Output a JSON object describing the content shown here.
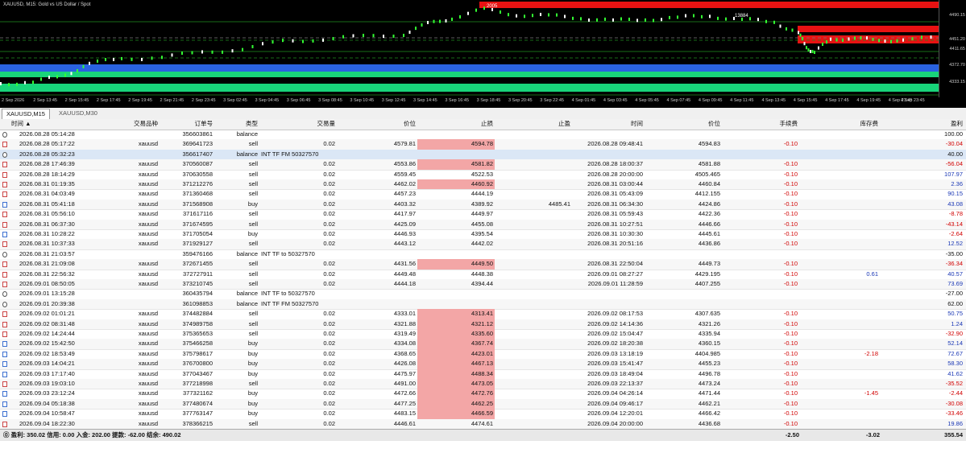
{
  "chart": {
    "title": "XAUUSD, M15:  Gold vs US Dollar / Spot",
    "price_labels": [
      "4490.15",
      "4451.20",
      "4411.65",
      "4372.70",
      "4333.15"
    ],
    "time_labels": [
      "2 Sep 2026",
      "2 Sep 13:45",
      "2 Sep 15:45",
      "2 Sep 17:45",
      "2 Sep 19:45",
      "2 Sep 21:45",
      "2 Sep 23:45",
      "3 Sep 02:45",
      "3 Sep 04:45",
      "3 Sep 06:45",
      "3 Sep 08:45",
      "3 Sep 10:45",
      "3 Sep 12:45",
      "3 Sep 14:45",
      "3 Sep 16:45",
      "3 Sep 18:45",
      "3 Sep 20:45",
      "3 Sep 22:45",
      "4 Sep 01:45",
      "4 Sep 03:45",
      "4 Sep 05:45",
      "4 Sep 07:45",
      "4 Sep 09:45",
      "4 Sep 11:45",
      "4 Sep 13:45",
      "4 Sep 15:45",
      "4 Sep 17:45",
      "4 Sep 19:45",
      "4 Sep 21:45",
      "4 Sep 23:45"
    ],
    "marker1": "2005",
    "marker2": "13884",
    "current_price": "4451.20",
    "colors": {
      "red_zone": "#e81212",
      "green_zone": "#18d47a",
      "blue_zone": "#2a62e0",
      "candle_up": "#33ff33",
      "candle_down": "#ffffff"
    }
  },
  "tabs": [
    {
      "label": "XAUUSD,M15",
      "active": true
    },
    {
      "label": "XAUUSD,M30",
      "active": false
    }
  ],
  "table": {
    "headers": [
      "时间",
      "交易品种",
      "订单号",
      "类型",
      "交易量",
      "价位",
      "止损",
      "止盈",
      "时间",
      "价位",
      "手续费",
      "库存费",
      "盈利"
    ],
    "rows": [
      {
        "icon": "bal",
        "time": "2026.08.28 05:14:28",
        "symbol": "",
        "order": "356603861",
        "type": "balance",
        "volume": "",
        "price": "",
        "sl": "",
        "tp": "",
        "ctime": "",
        "cprice": "",
        "commission": "",
        "swap": "",
        "profit": "100.00",
        "comment": "",
        "profit_sign": "bal"
      },
      {
        "icon": "sell",
        "time": "2026.08.28 05:17:22",
        "symbol": "xauusd",
        "order": "369641723",
        "type": "sell",
        "volume": "0.02",
        "price": "4579.81",
        "sl": "4594.78",
        "sl_hl": true,
        "tp": "",
        "ctime": "2026.08.28 09:48:41",
        "cprice": "4594.83",
        "commission": "-0.10",
        "swap": "",
        "profit": "-30.04",
        "profit_sign": "neg"
      },
      {
        "icon": "bal",
        "time": "2026.08.28 05:32:23",
        "symbol": "",
        "order": "356617407",
        "type": "balance",
        "volume": "",
        "price": "",
        "sl": "",
        "tp": "",
        "ctime": "",
        "cprice": "",
        "commission": "",
        "swap": "",
        "profit": "40.00",
        "comment": "INT TF FM 50327570",
        "profit_sign": "bal",
        "selected": true
      },
      {
        "icon": "sell",
        "time": "2026.08.28 17:46:39",
        "symbol": "xauusd",
        "order": "370560087",
        "type": "sell",
        "volume": "0.02",
        "price": "4553.86",
        "sl": "4581.82",
        "sl_hl": true,
        "tp": "",
        "ctime": "2026.08.28 18:00:37",
        "cprice": "4581.88",
        "commission": "-0.10",
        "swap": "",
        "profit": "-56.04",
        "profit_sign": "neg"
      },
      {
        "icon": "sell",
        "time": "2026.08.28 18:14:29",
        "symbol": "xauusd",
        "order": "370630558",
        "type": "sell",
        "volume": "0.02",
        "price": "4559.45",
        "sl": "4522.53",
        "tp": "",
        "ctime": "2026.08.28 20:00:00",
        "cprice": "4505.465",
        "commission": "-0.10",
        "swap": "",
        "profit": "107.97",
        "profit_sign": "pos"
      },
      {
        "icon": "sell",
        "time": "2026.08.31 01:19:35",
        "symbol": "xauusd",
        "order": "371212276",
        "type": "sell",
        "volume": "0.02",
        "price": "4462.02",
        "sl": "4460.92",
        "sl_hl": true,
        "tp": "",
        "ctime": "2026.08.31 03:00:44",
        "cprice": "4460.84",
        "commission": "-0.10",
        "swap": "",
        "profit": "2.36",
        "profit_sign": "pos"
      },
      {
        "icon": "sell",
        "time": "2026.08.31 04:03:49",
        "symbol": "xauusd",
        "order": "371360468",
        "type": "sell",
        "volume": "0.02",
        "price": "4457.23",
        "sl": "4444.19",
        "tp": "",
        "ctime": "2026.08.31 05:43:09",
        "cprice": "4412.155",
        "commission": "-0.10",
        "swap": "",
        "profit": "90.15",
        "profit_sign": "pos"
      },
      {
        "icon": "buy",
        "time": "2026.08.31 05:41:18",
        "symbol": "xauusd",
        "order": "371568908",
        "type": "buy",
        "volume": "0.02",
        "price": "4403.32",
        "sl": "4389.92",
        "tp": "4485.41",
        "ctime": "2026.08.31 06:34:30",
        "cprice": "4424.86",
        "commission": "-0.10",
        "swap": "",
        "profit": "43.08",
        "profit_sign": "pos"
      },
      {
        "icon": "sell",
        "time": "2026.08.31 05:56:10",
        "symbol": "xauusd",
        "order": "371617116",
        "type": "sell",
        "volume": "0.02",
        "price": "4417.97",
        "sl": "4449.97",
        "tp": "",
        "ctime": "2026.08.31 05:59:43",
        "cprice": "4422.36",
        "commission": "-0.10",
        "swap": "",
        "profit": "-8.78",
        "profit_sign": "neg"
      },
      {
        "icon": "sell",
        "time": "2026.08.31 06:37:30",
        "symbol": "xauusd",
        "order": "371674595",
        "type": "sell",
        "volume": "0.02",
        "price": "4425.09",
        "sl": "4455.08",
        "tp": "",
        "ctime": "2026.08.31 10:27:51",
        "cprice": "4446.66",
        "commission": "-0.10",
        "swap": "",
        "profit": "-43.14",
        "profit_sign": "neg"
      },
      {
        "icon": "buy",
        "time": "2026.08.31 10:28:22",
        "symbol": "xauusd",
        "order": "371705054",
        "type": "buy",
        "volume": "0.02",
        "price": "4446.93",
        "sl": "4395.54",
        "tp": "",
        "ctime": "2026.08.31 10:30:30",
        "cprice": "4445.61",
        "commission": "-0.10",
        "swap": "",
        "profit": "-2.64",
        "profit_sign": "neg"
      },
      {
        "icon": "sell",
        "time": "2026.08.31 10:37:33",
        "symbol": "xauusd",
        "order": "371929127",
        "type": "sell",
        "volume": "0.02",
        "price": "4443.12",
        "sl": "4442.02",
        "tp": "",
        "ctime": "2026.08.31 20:51:16",
        "cprice": "4436.86",
        "commission": "-0.10",
        "swap": "",
        "profit": "12.52",
        "profit_sign": "pos"
      },
      {
        "icon": "bal",
        "time": "2026.08.31 21:03:57",
        "symbol": "",
        "order": "359476166",
        "type": "balance",
        "volume": "",
        "price": "",
        "sl": "",
        "tp": "",
        "ctime": "",
        "cprice": "",
        "commission": "",
        "swap": "",
        "profit": "-35.00",
        "comment": "INT TF to 50327570",
        "profit_sign": "bal"
      },
      {
        "icon": "sell",
        "time": "2026.08.31 21:09:08",
        "symbol": "xauusd",
        "order": "372671455",
        "type": "sell",
        "volume": "0.02",
        "price": "4431.56",
        "sl": "4449.50",
        "sl_hl": true,
        "tp": "",
        "ctime": "2026.08.31 22:50:04",
        "cprice": "4449.73",
        "commission": "-0.10",
        "swap": "",
        "profit": "-36.34",
        "profit_sign": "neg"
      },
      {
        "icon": "sell",
        "time": "2026.08.31 22:56:32",
        "symbol": "xauusd",
        "order": "372727911",
        "type": "sell",
        "volume": "0.02",
        "price": "4449.48",
        "sl": "4448.38",
        "tp": "",
        "ctime": "2026.09.01 08:27:27",
        "cprice": "4429.195",
        "commission": "-0.10",
        "swap": "0.61",
        "profit": "40.57",
        "profit_sign": "pos"
      },
      {
        "icon": "sell",
        "time": "2026.09.01 08:50:05",
        "symbol": "xauusd",
        "order": "373210745",
        "type": "sell",
        "volume": "0.02",
        "price": "4444.18",
        "sl": "4394.44",
        "tp": "",
        "ctime": "2026.09.01 11:28:59",
        "cprice": "4407.255",
        "commission": "-0.10",
        "swap": "",
        "profit": "73.69",
        "profit_sign": "pos"
      },
      {
        "icon": "bal",
        "time": "2026.09.01 13:15:28",
        "symbol": "",
        "order": "360435794",
        "type": "balance",
        "volume": "",
        "price": "",
        "sl": "",
        "tp": "",
        "ctime": "",
        "cprice": "",
        "commission": "",
        "swap": "",
        "profit": "-27.00",
        "comment": "INT TF to 50327570",
        "profit_sign": "bal"
      },
      {
        "icon": "bal",
        "time": "2026.09.01 20:39:38",
        "symbol": "",
        "order": "361098853",
        "type": "balance",
        "volume": "",
        "price": "",
        "sl": "",
        "tp": "",
        "ctime": "",
        "cprice": "",
        "commission": "",
        "swap": "",
        "profit": "62.00",
        "comment": "INT TF FM 50327570",
        "profit_sign": "bal"
      },
      {
        "icon": "sell",
        "time": "2026.09.02 01:01:21",
        "symbol": "xauusd",
        "order": "374482884",
        "type": "sell",
        "volume": "0.02",
        "price": "4333.01",
        "sl": "4313.41",
        "sl_hl": true,
        "tp": "",
        "ctime": "2026.09.02 08:17:53",
        "cprice": "4307.635",
        "commission": "-0.10",
        "swap": "",
        "profit": "50.75",
        "profit_sign": "pos"
      },
      {
        "icon": "sell",
        "time": "2026.09.02 08:31:48",
        "symbol": "xauusd",
        "order": "374989758",
        "type": "sell",
        "volume": "0.02",
        "price": "4321.88",
        "sl": "4321.12",
        "sl_hl": true,
        "tp": "",
        "ctime": "2026.09.02 14:14:36",
        "cprice": "4321.26",
        "commission": "-0.10",
        "swap": "",
        "profit": "1.24",
        "profit_sign": "pos"
      },
      {
        "icon": "sell",
        "time": "2026.09.02 14:24:44",
        "symbol": "xauusd",
        "order": "375365653",
        "type": "sell",
        "volume": "0.02",
        "price": "4319.49",
        "sl": "4335.60",
        "sl_hl": true,
        "tp": "",
        "ctime": "2026.09.02 15:04:47",
        "cprice": "4335.94",
        "commission": "-0.10",
        "swap": "",
        "profit": "-32.90",
        "profit_sign": "neg"
      },
      {
        "icon": "buy",
        "time": "2026.09.02 15:42:50",
        "symbol": "xauusd",
        "order": "375466258",
        "type": "buy",
        "volume": "0.02",
        "price": "4334.08",
        "sl": "4367.74",
        "sl_hl": true,
        "tp": "",
        "ctime": "2026.09.02 18:20:38",
        "cprice": "4360.15",
        "commission": "-0.10",
        "swap": "",
        "profit": "52.14",
        "profit_sign": "pos"
      },
      {
        "icon": "buy",
        "time": "2026.09.02 18:53:49",
        "symbol": "xauusd",
        "order": "375798617",
        "type": "buy",
        "volume": "0.02",
        "price": "4368.65",
        "sl": "4423.01",
        "sl_hl": true,
        "tp": "",
        "ctime": "2026.09.03 13:18:19",
        "cprice": "4404.985",
        "commission": "-0.10",
        "swap": "-2.18",
        "profit": "72.67",
        "profit_sign": "pos"
      },
      {
        "icon": "buy",
        "time": "2026.09.03 14:04:21",
        "symbol": "xauusd",
        "order": "376700800",
        "type": "buy",
        "volume": "0.02",
        "price": "4426.08",
        "sl": "4467.13",
        "sl_hl": true,
        "tp": "",
        "ctime": "2026.09.03 15:41:47",
        "cprice": "4455.23",
        "commission": "-0.10",
        "swap": "",
        "profit": "58.30",
        "profit_sign": "pos"
      },
      {
        "icon": "buy",
        "time": "2026.09.03 17:17:40",
        "symbol": "xauusd",
        "order": "377043467",
        "type": "buy",
        "volume": "0.02",
        "price": "4475.97",
        "sl": "4488.34",
        "sl_hl": true,
        "tp": "",
        "ctime": "2026.09.03 18:49:04",
        "cprice": "4496.78",
        "commission": "-0.10",
        "swap": "",
        "profit": "41.62",
        "profit_sign": "pos"
      },
      {
        "icon": "sell",
        "time": "2026.09.03 19:03:10",
        "symbol": "xauusd",
        "order": "377218998",
        "type": "sell",
        "volume": "0.02",
        "price": "4491.00",
        "sl": "4473.05",
        "sl_hl": true,
        "tp": "",
        "ctime": "2026.09.03 22:13:37",
        "cprice": "4473.24",
        "commission": "-0.10",
        "swap": "",
        "profit": "-35.52",
        "profit_sign": "neg"
      },
      {
        "icon": "buy",
        "time": "2026.09.03 23:12:24",
        "symbol": "xauusd",
        "order": "377321162",
        "type": "buy",
        "volume": "0.02",
        "price": "4472.66",
        "sl": "4472.76",
        "sl_hl": true,
        "tp": "",
        "ctime": "2026.09.04 04:26:14",
        "cprice": "4471.44",
        "commission": "-0.10",
        "swap": "-1.45",
        "profit": "-2.44",
        "profit_sign": "neg"
      },
      {
        "icon": "buy",
        "time": "2026.09.04 05:18:38",
        "symbol": "xauusd",
        "order": "377480674",
        "type": "buy",
        "volume": "0.02",
        "price": "4477.25",
        "sl": "4462.25",
        "sl_hl": true,
        "tp": "",
        "ctime": "2026.09.04 09:46:17",
        "cprice": "4462.21",
        "commission": "-0.10",
        "swap": "",
        "profit": "-30.08",
        "profit_sign": "neg"
      },
      {
        "icon": "buy",
        "time": "2026.09.04 10:58:47",
        "symbol": "xauusd",
        "order": "377763147",
        "type": "buy",
        "volume": "0.02",
        "price": "4483.15",
        "sl": "4466.59",
        "sl_hl": true,
        "tp": "",
        "ctime": "2026.09.04 12:20:01",
        "cprice": "4466.42",
        "commission": "-0.10",
        "swap": "",
        "profit": "-33.46",
        "profit_sign": "neg"
      },
      {
        "icon": "sell",
        "time": "2026.09.04 18:22:30",
        "symbol": "xauusd",
        "order": "378366215",
        "type": "sell",
        "volume": "0.02",
        "price": "4446.61",
        "sl": "4474.61",
        "tp": "",
        "ctime": "2026.09.04 20:00:00",
        "cprice": "4436.68",
        "commission": "-0.10",
        "swap": "",
        "profit": "19.86",
        "profit_sign": "pos"
      }
    ]
  },
  "footer": {
    "summary": "盈利: 350.02  信用: 0.00  入金: 202.00  提款: -62.00  结余: 490.02",
    "commission_total": "-2.50",
    "swap_total": "-3.02",
    "profit_total": "355.54"
  }
}
